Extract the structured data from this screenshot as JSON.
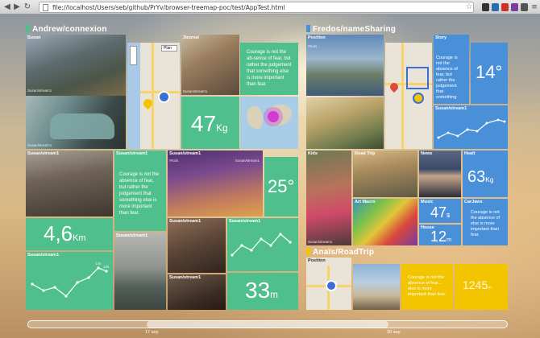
{
  "browser": {
    "url": "file://localhost/Users/seb/github/PrYv/browser-treemap-poc/test/AppTest.html"
  },
  "colors": {
    "green": "#4fc08d",
    "blue": "#4a90d9",
    "yellow": "#f2c500"
  },
  "groups": {
    "andrew": {
      "title": "Andrew/connexion",
      "color": "#4fc08d"
    },
    "fredos": {
      "title": "Fredos/nameSharing",
      "color": "#4a90d9"
    },
    "anais": {
      "title": "Anaïs/RoadTrip",
      "color": "#f2c500"
    }
  },
  "andrew": {
    "susan_label": "Susan",
    "susan_caption1": "Susan/stream1",
    "susan_caption2": "Susan/stream1",
    "map_plan": "Plan",
    "journal_label": "Journal",
    "journal_caption": "Susan/stream1",
    "journal_quote": "Courage is not the ab-sence of fear, but rather the judgement that something else is more important than fear.",
    "weight_value": "47",
    "weight_unit": "Kg",
    "tile_a_label": "Susan/stream1",
    "tile_b_label": "Susan/stream1",
    "tile_c_label": "Susan/stream1",
    "tile_c_city": "#Kids",
    "tile_c_caption": "Susan/stream1",
    "tile_b_quote": "Courage is not the absence of fear, but rather the judgement that something else is more important than fear.",
    "temp_value": "25°",
    "dist_value": "4,6",
    "dist_unit": "Km",
    "graph1_label": "Susan/stream1",
    "graph1_points": [
      "145",
      "185"
    ],
    "tile_d_label": "Susan/stream1",
    "tile_e_label": "Susan/stream1",
    "tile_f_label": "Susan/stream1",
    "tile_g_label": "Susan/stream1",
    "dur_value": "33",
    "dur_unit": "m"
  },
  "fredos": {
    "position_label": "Position",
    "position_caption": "#Kids",
    "story_label": "Story",
    "story_quote": "Courage is not the absence of fear, but rather the judgement that something",
    "story_temp": "14°",
    "story_graph_label": "Susan/stream1",
    "kids_label": "Kids",
    "kids_caption": "Susan/stream1",
    "road_trip_label": "Road Trip",
    "news_label": "News",
    "health_label": "Healt",
    "health_value": "63",
    "health_unit": "Kg",
    "art_label": "Art Macro",
    "music_label": "Music",
    "music_value": "47",
    "music_unit": "$",
    "carjaws_label": "CarJaws",
    "carjaws_quote": "Courage is not the absence of else is more important than fear.",
    "house_label": "House",
    "house_value": "12",
    "house_unit": "m"
  },
  "anais": {
    "position_label": "Position",
    "quote": "Courage is not the absence of fear... else is more important than fear.",
    "value": "1245",
    "unit": "m"
  },
  "timeline": {
    "tick1": "17 sep",
    "tick2": "30 sep"
  }
}
